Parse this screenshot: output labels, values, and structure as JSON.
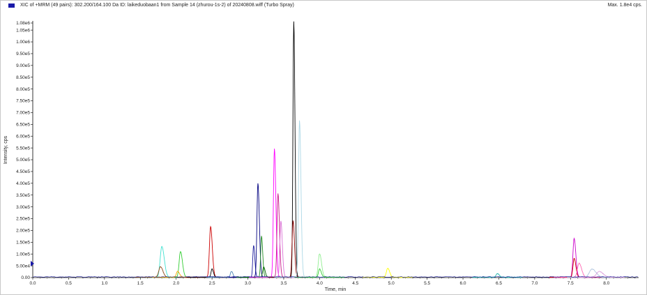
{
  "header": {
    "title": "XIC of +MRM (49 pairs): 302.200/164.100 Da ID: laikeduobaan1 from Sample 14 (zhurou-1s-2) of 20240808.wiff (Turbo Spray)",
    "max_label": "Max. 1.8e4 cps."
  },
  "chart_data": {
    "type": "line",
    "xlabel": "Time, min",
    "ylabel": "Intensity, cps",
    "xlim": [
      0.0,
      8.45
    ],
    "ylim": [
      0,
      1100000
    ],
    "x_ticks": [
      "0.0",
      "0.5",
      "1.0",
      "1.5",
      "2.0",
      "2.5",
      "3.0",
      "3.5",
      "4.0",
      "4.5",
      "5.0",
      "5.5",
      "6.0",
      "6.5",
      "7.0",
      "7.5",
      "8.0"
    ],
    "x_tick_values": [
      0.0,
      0.5,
      1.0,
      1.5,
      2.0,
      2.5,
      3.0,
      3.5,
      4.0,
      4.5,
      5.0,
      5.5,
      6.0,
      6.5,
      7.0,
      7.5,
      8.0
    ],
    "y_ticks": [
      "0.00",
      "5.00e4",
      "1.00e5",
      "1.50e5",
      "2.00e5",
      "2.50e5",
      "3.00e5",
      "3.50e5",
      "4.00e5",
      "4.50e5",
      "5.00e5",
      "5.50e5",
      "6.00e5",
      "6.50e5",
      "7.00e5",
      "7.50e5",
      "8.00e5",
      "8.50e5",
      "9.00e5",
      "9.50e5",
      "1.00e6",
      "1.05e6",
      "1.08e6"
    ],
    "y_tick_values": [
      0,
      50000,
      100000,
      150000,
      200000,
      250000,
      300000,
      350000,
      400000,
      450000,
      500000,
      550000,
      600000,
      650000,
      700000,
      750000,
      800000,
      850000,
      900000,
      950000,
      1000000,
      1050000,
      1080000
    ],
    "peaks": [
      {
        "color": "#40e0d0",
        "rt": 1.8,
        "height": 130000,
        "width": 0.05
      },
      {
        "color": "#8b4513",
        "rt": 1.78,
        "height": 45000,
        "width": 0.05
      },
      {
        "color": "#32cd32",
        "rt": 2.06,
        "height": 110000,
        "width": 0.04
      },
      {
        "color": "#ffa500",
        "rt": 2.02,
        "height": 25000,
        "width": 0.04
      },
      {
        "color": "#cc0000",
        "rt": 2.48,
        "height": 215000,
        "width": 0.035
      },
      {
        "color": "#000000",
        "rt": 2.5,
        "height": 35000,
        "width": 0.03
      },
      {
        "color": "#4682b4",
        "rt": 2.77,
        "height": 25000,
        "width": 0.03
      },
      {
        "color": "#1a1a9c",
        "rt": 3.08,
        "height": 135000,
        "width": 0.025
      },
      {
        "color": "#000080",
        "rt": 3.14,
        "height": 398000,
        "width": 0.03
      },
      {
        "color": "#228b22",
        "rt": 3.19,
        "height": 175000,
        "width": 0.025
      },
      {
        "color": "#006400",
        "rt": 3.22,
        "height": 45000,
        "width": 0.03
      },
      {
        "color": "#ff00ff",
        "rt": 3.37,
        "height": 545000,
        "width": 0.03
      },
      {
        "color": "#c71585",
        "rt": 3.42,
        "height": 355000,
        "width": 0.03
      },
      {
        "color": "#da70d6",
        "rt": 3.46,
        "height": 240000,
        "width": 0.03
      },
      {
        "color": "#000000",
        "rt": 3.64,
        "height": 1085000,
        "width": 0.025
      },
      {
        "color": "#8b0000",
        "rt": 3.63,
        "height": 240000,
        "width": 0.03
      },
      {
        "color": "#add8e6",
        "rt": 3.72,
        "height": 665000,
        "width": 0.03
      },
      {
        "color": "#90ee90",
        "rt": 4.0,
        "height": 100000,
        "width": 0.04
      },
      {
        "color": "#32cd32",
        "rt": 4.0,
        "height": 35000,
        "width": 0.035
      },
      {
        "color": "#ffff00",
        "rt": 4.95,
        "height": 38000,
        "width": 0.04
      },
      {
        "color": "#20b2aa",
        "rt": 6.48,
        "height": 15000,
        "width": 0.04
      },
      {
        "color": "#cc00cc",
        "rt": 7.55,
        "height": 165000,
        "width": 0.035
      },
      {
        "color": "#cc0000",
        "rt": 7.55,
        "height": 80000,
        "width": 0.035
      },
      {
        "color": "#ff69b4",
        "rt": 7.62,
        "height": 60000,
        "width": 0.05
      },
      {
        "color": "#b0c4de",
        "rt": 7.8,
        "height": 35000,
        "width": 0.08
      },
      {
        "color": "#dda0dd",
        "rt": 7.9,
        "height": 25000,
        "width": 0.08
      }
    ]
  }
}
